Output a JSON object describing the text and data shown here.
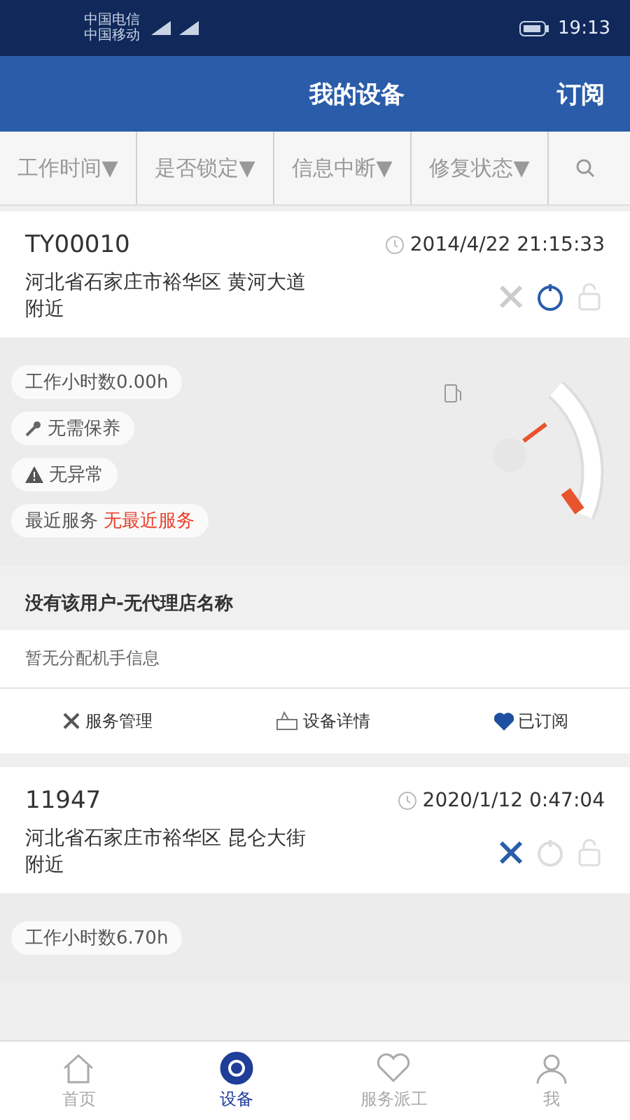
{
  "status_bar": {
    "carriers": [
      "中国电信",
      "中国移动"
    ],
    "time": "19:13"
  },
  "header": {
    "title": "我的设备",
    "action": "订阅"
  },
  "filters": [
    {
      "label": "工作时间",
      "arrow": "▼"
    },
    {
      "label": "是否锁定",
      "arrow": "▼"
    },
    {
      "label": "信息中断",
      "arrow": "▼"
    },
    {
      "label": "修复状态",
      "arrow": "▼"
    }
  ],
  "devices": [
    {
      "id": "TY00010",
      "time": "2014/4/22 21:15:33",
      "address": "河北省石家庄市裕华区 黄河大道附近",
      "gps_on": false,
      "power_on": true,
      "locked": false,
      "hours": "工作小时数0.00h",
      "maintenance": "无需保养",
      "alarm": "无异常",
      "service_label": "最近服务",
      "service_value": "无最近服务",
      "agent": "没有该用户-无代理店名称",
      "operator": "暂无分配机手信息",
      "actions": [
        {
          "kind": "service",
          "label": "服务管理"
        },
        {
          "kind": "detail",
          "label": "设备详情"
        },
        {
          "kind": "subscribe",
          "label": "已订阅",
          "on": true
        }
      ]
    },
    {
      "id": "11947",
      "time": "2020/1/12 0:47:04",
      "address": "河北省石家庄市裕华区 昆仑大街附近",
      "gps_on": true,
      "power_on": false,
      "locked": false,
      "hours": "工作小时数6.70h"
    }
  ],
  "tabs": [
    {
      "label": "首页",
      "kind": "home",
      "selected": false
    },
    {
      "label": "设备",
      "kind": "devices",
      "selected": true
    },
    {
      "label": "服务派工",
      "kind": "dispatch",
      "selected": false
    },
    {
      "label": "我",
      "kind": "profile",
      "selected": false
    }
  ]
}
